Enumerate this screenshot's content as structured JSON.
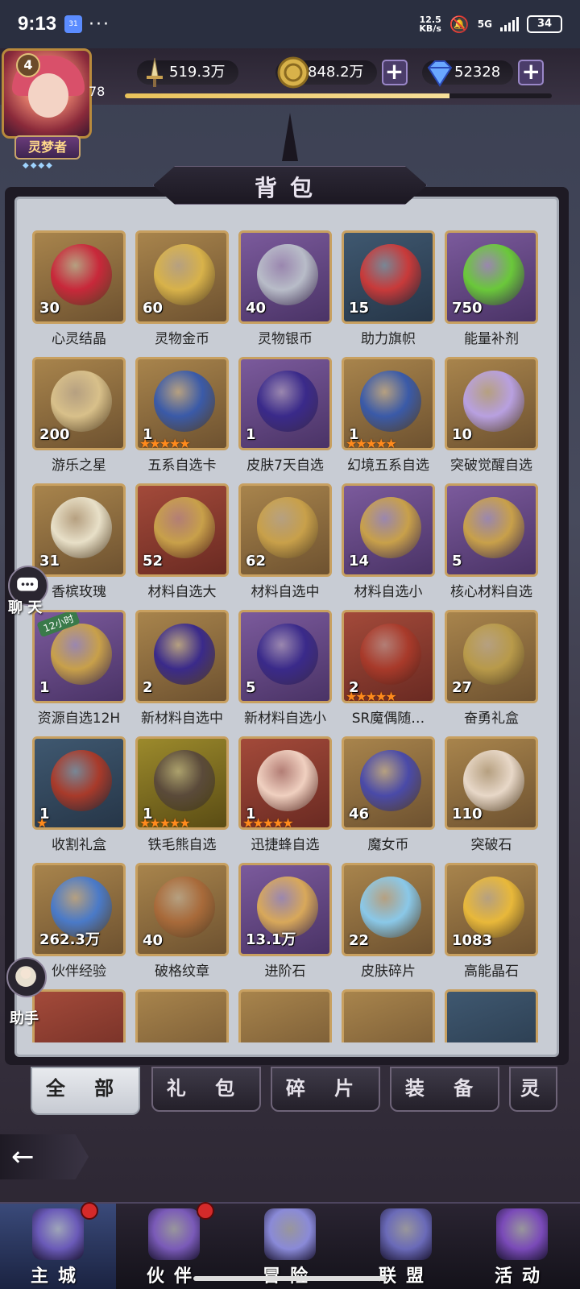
{
  "status_bar": {
    "time": "9:13",
    "calendar_icon": "31",
    "more": "···",
    "net_speed_value": "12.5",
    "net_speed_unit": "KB/s",
    "signal": "5G",
    "battery": "34"
  },
  "player": {
    "level": "4",
    "level_number": "78",
    "rank": "灵梦者",
    "rank_stars": "◆◆◆◆",
    "xp_fraction": 0.76
  },
  "resources": [
    {
      "name": "sword",
      "value": "519.3万",
      "has_plus": false
    },
    {
      "name": "gold-coin",
      "value": "848.2万",
      "has_plus": true
    },
    {
      "name": "diamond",
      "value": "52328",
      "has_plus": true
    }
  ],
  "panel": {
    "title": "背包"
  },
  "items": [
    {
      "name": "心灵结晶",
      "count": "30",
      "frame": "gold",
      "art": "#c8283a",
      "stars": ""
    },
    {
      "name": "灵物金币",
      "count": "60",
      "frame": "gold",
      "art": "#d8b24a",
      "stars": ""
    },
    {
      "name": "灵物银币",
      "count": "40",
      "frame": "purple",
      "art": "#b8bcc8",
      "stars": ""
    },
    {
      "name": "助力旗帜",
      "count": "15",
      "frame": "blue",
      "art": "#c83a3a",
      "stars": ""
    },
    {
      "name": "能量补剂",
      "count": "750",
      "frame": "purple",
      "art": "#6ac83a",
      "stars": ""
    },
    {
      "name": "游乐之星",
      "count": "200",
      "frame": "gold",
      "art": "#d8c08a",
      "stars": ""
    },
    {
      "name": "五系自选卡",
      "count": "1",
      "frame": "gold",
      "art": "#3a5aa8",
      "stars": "★★★★★"
    },
    {
      "name": "皮肤7天自选",
      "count": "1",
      "frame": "purple",
      "art": "#3a2a8a",
      "stars": ""
    },
    {
      "name": "幻境五系自选",
      "count": "1",
      "frame": "gold",
      "art": "#3a5aa8",
      "stars": "★★★★★"
    },
    {
      "name": "突破觉醒自选",
      "count": "10",
      "frame": "gold",
      "art": "#b8a0e0",
      "stars": ""
    },
    {
      "name": "香槟玫瑰",
      "count": "31",
      "frame": "gold",
      "art": "#e8e0c8",
      "stars": ""
    },
    {
      "name": "材料自选大",
      "count": "52",
      "frame": "red",
      "art": "#c8a04a",
      "stars": ""
    },
    {
      "name": "材料自选中",
      "count": "62",
      "frame": "gold",
      "art": "#c8a04a",
      "stars": ""
    },
    {
      "name": "材料自选小",
      "count": "14",
      "frame": "purple",
      "art": "#c8a04a",
      "stars": ""
    },
    {
      "name": "核心材料自选",
      "count": "5",
      "frame": "purple",
      "art": "#c8a04a",
      "stars": ""
    },
    {
      "name": "资源自选12H",
      "count": "1",
      "frame": "purple",
      "art": "#c8a04a",
      "stars": "",
      "badge": "12小时"
    },
    {
      "name": "新材料自选中",
      "count": "2",
      "frame": "gold",
      "art": "#3a2a8a",
      "stars": ""
    },
    {
      "name": "新材料自选小",
      "count": "5",
      "frame": "purple",
      "art": "#3a2a8a",
      "stars": ""
    },
    {
      "name": "SR魔偶随…",
      "count": "2",
      "frame": "red",
      "art": "#a83a2a",
      "stars": "★★★★★"
    },
    {
      "name": "奋勇礼盒",
      "count": "27",
      "frame": "gold",
      "art": "#b89a4a",
      "stars": ""
    },
    {
      "name": "收割礼盒",
      "count": "1",
      "frame": "blue",
      "art": "#a83a2a",
      "stars": "★"
    },
    {
      "name": "铁毛熊自选",
      "count": "1",
      "frame": "yellow",
      "art": "#5a4a3a",
      "stars": "★★★★★"
    },
    {
      "name": "迅捷蜂自选",
      "count": "1",
      "frame": "red",
      "art": "#f0d0c0",
      "stars": "★★★★★"
    },
    {
      "name": "魔女币",
      "count": "46",
      "frame": "gold",
      "art": "#4a4aa8",
      "stars": ""
    },
    {
      "name": "突破石",
      "count": "110",
      "frame": "gold",
      "art": "#e8d8c8",
      "stars": ""
    },
    {
      "name": "伙伴经验",
      "count": "262.3万",
      "frame": "gold",
      "art": "#4a7ac8",
      "stars": ""
    },
    {
      "name": "破格纹章",
      "count": "40",
      "frame": "gold",
      "art": "#a86a3a",
      "stars": ""
    },
    {
      "name": "进阶石",
      "count": "13.1万",
      "frame": "purple",
      "art": "#d8a85a",
      "stars": ""
    },
    {
      "name": "皮肤碎片",
      "count": "22",
      "frame": "gold",
      "art": "#8ac8e8",
      "stars": ""
    },
    {
      "name": "高能晶石",
      "count": "1083",
      "frame": "gold",
      "art": "#e8b83a",
      "stars": ""
    }
  ],
  "side": {
    "chat": "聊 天",
    "assistant": "助手"
  },
  "tabs": [
    "全 部",
    "礼 包",
    "碎 片",
    "装 备",
    "灵"
  ],
  "back_icon": "←",
  "bottom_nav": [
    {
      "label": "主城",
      "active": true,
      "dot": true
    },
    {
      "label": "伙伴",
      "active": false,
      "dot": true
    },
    {
      "label": "冒险",
      "active": false,
      "dot": false
    },
    {
      "label": "联盟",
      "active": false,
      "dot": false
    },
    {
      "label": "活动",
      "active": false,
      "dot": false
    }
  ],
  "colors": {
    "accent_gold": "#c8a060",
    "notification_red": "#d42a2a"
  }
}
